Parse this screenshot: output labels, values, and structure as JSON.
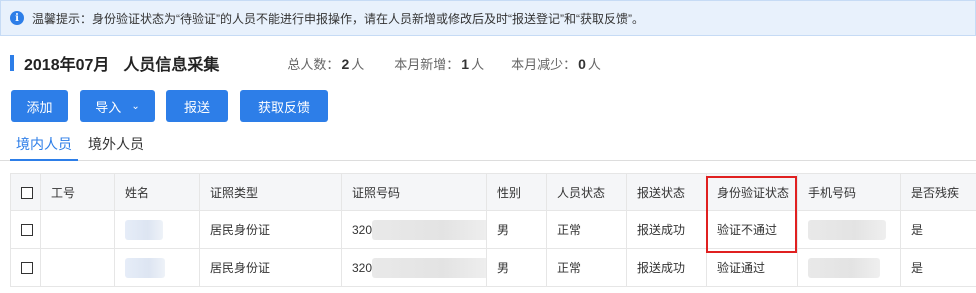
{
  "notice": {
    "icon": "info-icon",
    "text": "温馨提示：身份验证状态为“待验证”的人员不能进行申报操作，请在人员新增或修改后及时“报送登记”和“获取反馈”。"
  },
  "header": {
    "period": "2018年07月",
    "title": "人员信息采集",
    "stats": [
      {
        "label": "总人数：",
        "value": "2",
        "unit": "人"
      },
      {
        "label": "本月新增：",
        "value": "1",
        "unit": "人"
      },
      {
        "label": "本月减少：",
        "value": "0",
        "unit": "人"
      }
    ]
  },
  "toolbar": {
    "add_label": "添加",
    "import_label": "导入",
    "submit_label": "报送",
    "feedback_label": "获取反馈"
  },
  "tabs": [
    {
      "label": "境内人员",
      "active": true
    },
    {
      "label": "境外人员",
      "active": false
    }
  ],
  "table": {
    "columns": [
      "工号",
      "姓名",
      "证照类型",
      "证照号码",
      "性别",
      "人员状态",
      "报送状态",
      "身份验证状态",
      "手机号码",
      "是否残疾"
    ],
    "rows": [
      {
        "id_type": "居民身份证",
        "id_prefix": "320",
        "gender": "男",
        "status": "正常",
        "submit_status": "报送成功",
        "verify_status": "验证不通过",
        "disabled": "是"
      },
      {
        "id_type": "居民身份证",
        "id_prefix": "320",
        "gender": "男",
        "status": "正常",
        "submit_status": "报送成功",
        "verify_status": "验证通过",
        "disabled": "是"
      }
    ]
  },
  "colors": {
    "accent": "#2d7ee8",
    "highlight": "#e02020",
    "notice_bg": "#e8f1fc"
  }
}
